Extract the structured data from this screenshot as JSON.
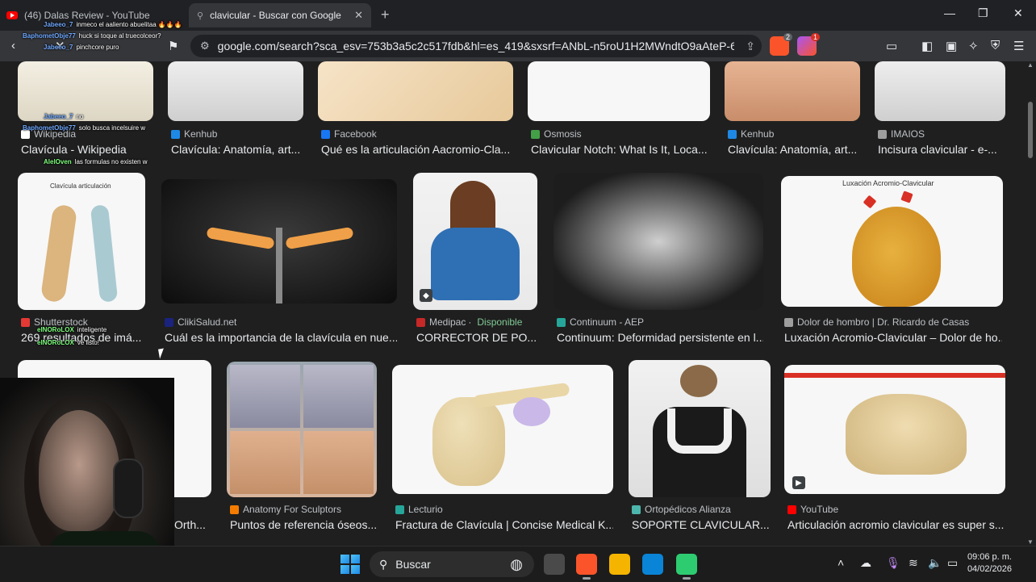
{
  "browser": {
    "tabs": [
      {
        "title": "(46) Dalas Review - YouTube",
        "active": false
      },
      {
        "title": "clavicular - Buscar con Google",
        "active": true
      }
    ],
    "url": "google.com/search?sca_esv=753b3a5c2c517fdb&hl=es_419&sxsrf=ANbL-n5roU1H2MWndtO9aAteP-64b6a...",
    "brave_badge_count": "2",
    "alert_badge_count": "1"
  },
  "results": [
    {
      "source": "Wikipedia",
      "title": "Clavícula - Wikipedia"
    },
    {
      "source": "Kenhub",
      "title": "Clavícula: Anatomía, art..."
    },
    {
      "source": "Facebook",
      "title": "Qué es la articulación Aacromio-Cla..."
    },
    {
      "source": "Osmosis",
      "title": "Clavicular Notch: What Is It, Loca..."
    },
    {
      "source": "Kenhub",
      "title": "Clavícula: Anatomía, art..."
    },
    {
      "source": "IMAIOS",
      "title": "Incisura clavicular - e-..."
    },
    {
      "source": "Shutterstock",
      "title": "269 resultados de imá..."
    },
    {
      "source": "ClikiSalud.net",
      "title": "Cuál es la importancia de la clavícula en nue..."
    },
    {
      "source": "Medipac",
      "availability": "Disponible",
      "title": "CORRECTOR DE PO..."
    },
    {
      "source": "Continuum - AEP",
      "title": "Continuum: Deformidad persistente en l..."
    },
    {
      "source": "Dolor de hombro | Dr. Ricardo de Casas",
      "title": "Luxación Acromio-Clavicular – Dolor de ho..."
    },
    {
      "source": "",
      "title": "Orth..."
    },
    {
      "source": "Anatomy For Sculptors",
      "title": "Puntos de referencia óseos..."
    },
    {
      "source": "Lecturio",
      "title": "Fractura de Clavícula | Concise Medical K..."
    },
    {
      "source": "Ortopédicos Alianza",
      "title": "SOPORTE CLAVICULAR..."
    },
    {
      "source": "YouTube",
      "title": "Articulación acromio clavicular es super s..."
    }
  ],
  "image_labels": {
    "clavicula_articulacion": "Clavícula articulación",
    "luxacion": "Luxación Acromio-Clavicular"
  },
  "chat": [
    {
      "user": "Jabeeo_7",
      "text": "inmeco el aaliento abuelitaa 🔥🔥🔥"
    },
    {
      "user": "BaphometObje77",
      "text": "huck si toque al truecolceor?"
    },
    {
      "user": "Jabeeo_7",
      "text": "pinchcore puro"
    },
    {
      "user": "BaphometObje77",
      "text": "solo busca incelsuire w"
    },
    {
      "user": "Jabeeo_7",
      "text": "no"
    },
    {
      "user": "AlelOven",
      "text": "las formulas no existen w"
    },
    {
      "user": "eINORoLOX",
      "text": "inteligente"
    },
    {
      "user": "eINORoLOX",
      "text": "ve listo!"
    }
  ],
  "taskbar": {
    "search_label": "Buscar",
    "time": "09:06 p. m.",
    "date": "04/02/2026"
  },
  "colors": {
    "page_bg": "#1f1f1f",
    "tab_active": "#35363a",
    "available_green": "#81c995",
    "brave_orange": "#fb542b"
  }
}
